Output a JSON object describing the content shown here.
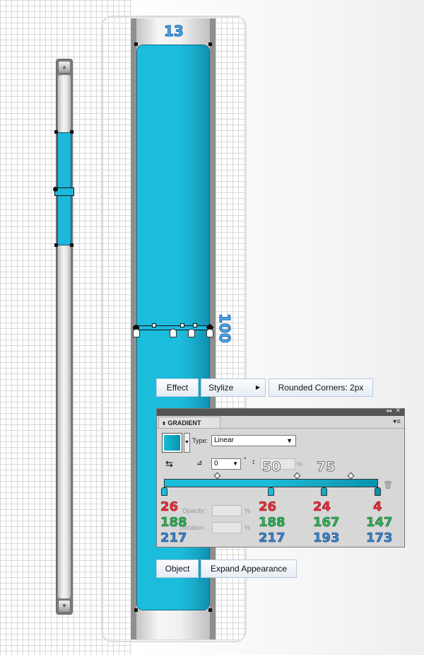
{
  "labels": {
    "top_number": "13",
    "side_number": "100"
  },
  "menus": {
    "effect": "Effect",
    "stylize": "Stylize",
    "rounded_corners": "Rounded Corners: 2px",
    "object": "Object",
    "expand_appearance": "Expand Appearance"
  },
  "gradient_panel": {
    "title": "GRADIENT",
    "type_label": "Type:",
    "type_value": "Linear",
    "angle_value": "0",
    "degree": "°",
    "percent": "%",
    "opacity_label": "Opacity:",
    "location_label": "Location:",
    "midpoint_labels": [
      "50",
      "75"
    ]
  },
  "stops": [
    {
      "r": "26",
      "g": "188",
      "b": "217",
      "color": "#1abcd9"
    },
    {
      "r": "26",
      "g": "188",
      "b": "217",
      "color": "#1abcd9"
    },
    {
      "r": "24",
      "g": "167",
      "b": "193",
      "color": "#18a7c1"
    },
    {
      "r": "4",
      "g": "147",
      "b": "173",
      "color": "#0493ad"
    }
  ],
  "colors": {
    "accent_blue": "#1cb8db",
    "number_blue": "#4aa8e6"
  },
  "icons": [
    "up-arrow-icon",
    "down-arrow-icon",
    "swap-gradient-icon",
    "angle-icon",
    "aspect-ratio-icon",
    "trash-icon",
    "panel-menu-icon",
    "collapse-icon",
    "submenu-arrow-icon",
    "dropdown-arrow-icon"
  ]
}
